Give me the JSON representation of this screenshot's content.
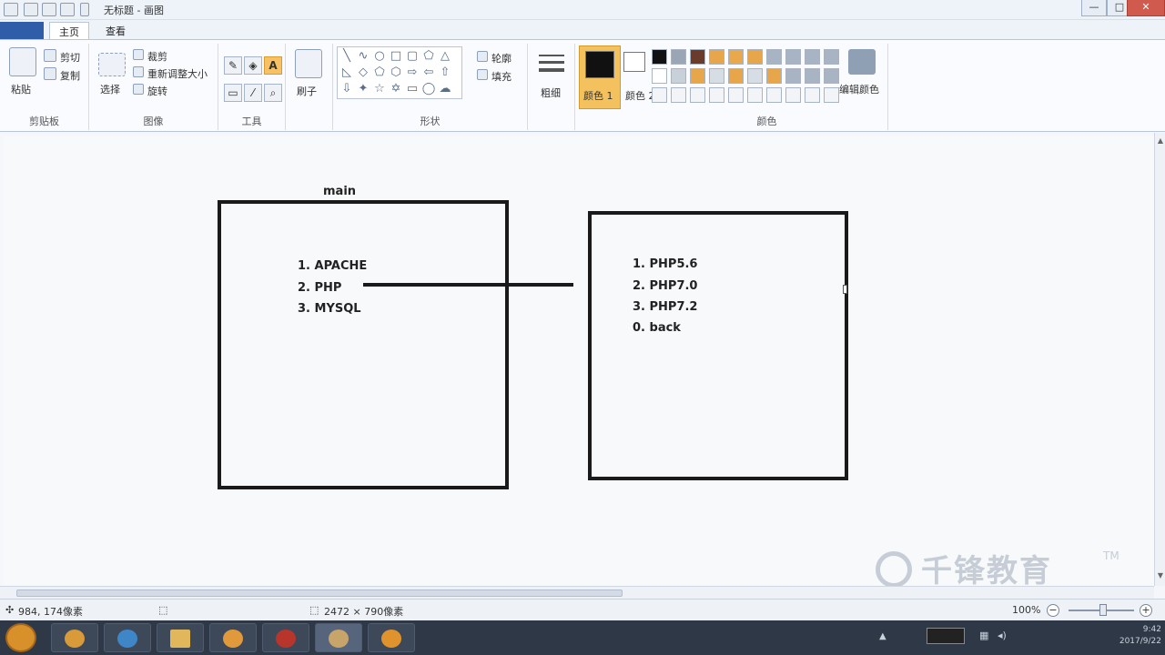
{
  "window": {
    "title": "无标题 - 画图",
    "controls": [
      "—",
      "□",
      "✕"
    ]
  },
  "tabs": {
    "file": "",
    "home": "主页",
    "view": "查看"
  },
  "ribbon": {
    "clipboard": {
      "paste": "粘贴",
      "cut": "剪切",
      "copy": "复制",
      "label": "剪贴板"
    },
    "image": {
      "select": "选择",
      "crop": "裁剪",
      "resize": "重新调整大小",
      "rotate": "旋转",
      "label": "图像"
    },
    "tools": {
      "label": "工具"
    },
    "brushes": {
      "label": "刷子"
    },
    "shapes": {
      "outline": "轮廓",
      "fill": "填充",
      "label": "形状"
    },
    "size": {
      "label": "粗细"
    },
    "color1": {
      "label": "颜色 1"
    },
    "color2": {
      "label": "颜色 2"
    },
    "colors": {
      "edit": "编辑颜色",
      "label": "颜色"
    }
  },
  "canvas": {
    "main_box": {
      "title": "main",
      "items": [
        "1. APACHE",
        "2. PHP",
        "3. MYSQL"
      ]
    },
    "php_box": {
      "items": [
        "1. PHP5.6",
        "2. PHP7.0",
        "3. PHP7.2",
        "0. back"
      ]
    },
    "watermark": "千锋教育",
    "watermark_tm": "TM"
  },
  "status": {
    "cursor_pos": "984, 174像素",
    "image_size": "2472 × 790像素",
    "zoom": "100%"
  },
  "taskbar": {
    "clock_time": "9:42",
    "clock_date": "2017/9/22"
  },
  "colors": {
    "ribbon_accent": "#f4c15f",
    "file_tab": "#2f5da8",
    "taskbar": "#2f3846",
    "stroke": "#1a1a1a"
  }
}
